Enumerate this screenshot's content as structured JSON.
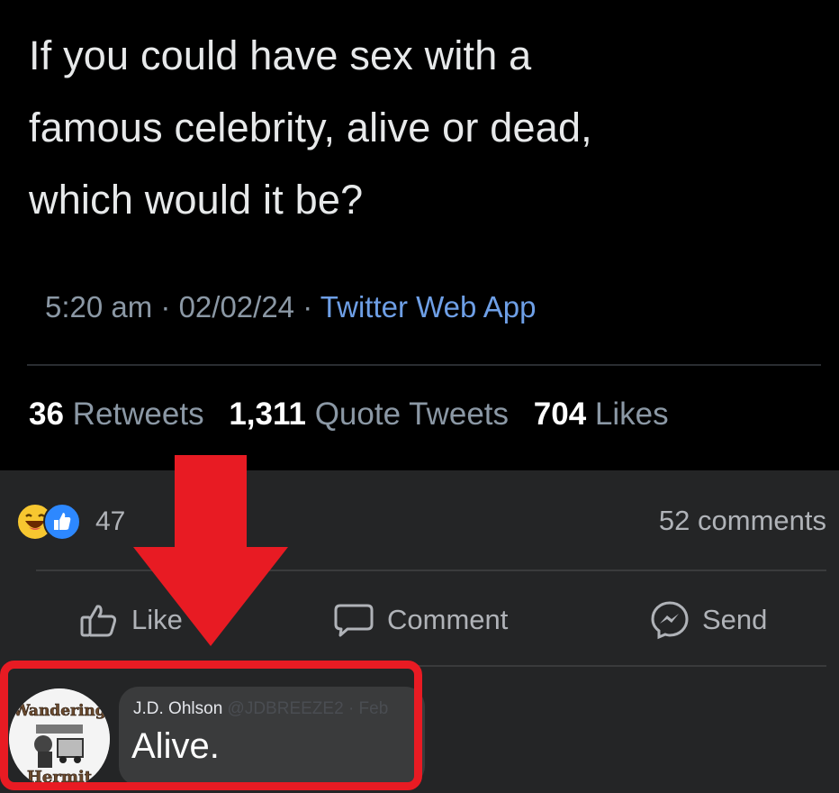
{
  "tweet": {
    "lines": [
      "If you could have sex with a",
      "famous celebrity, alive or dead,",
      "which would it be?"
    ],
    "time": "5:20 am",
    "date": "02/02/24",
    "separator": " · ",
    "source": "Twitter Web App",
    "stats": {
      "retweets_count": "36",
      "retweets_label": "Retweets",
      "quotes_count": "1,311",
      "quotes_label": "Quote Tweets",
      "likes_count": "704",
      "likes_label": "Likes"
    }
  },
  "facebook": {
    "reaction_count": "47",
    "comments_count": "52 comments",
    "actions": {
      "like": "Like",
      "comment": "Comment",
      "send": "Send"
    },
    "comment": {
      "author": "J.D. Ohlson",
      "handle": "@JDBREEZE2",
      "dot": "·",
      "time": "Feb",
      "text": "Alive.",
      "avatar_text_top": "Wandering",
      "avatar_text_bottom": "Hermit"
    }
  },
  "colors": {
    "annotation_red": "#e81b23",
    "source_link": "#6e9fe6",
    "fb_bg": "#242526"
  }
}
